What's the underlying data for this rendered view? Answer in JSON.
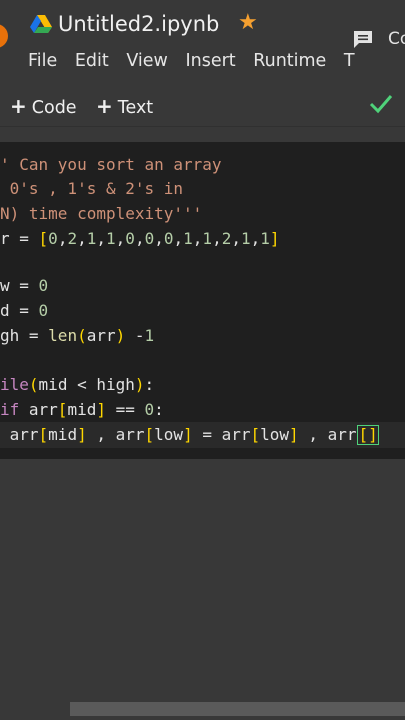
{
  "header": {
    "title": "Untitled2.ipynb",
    "share_label": "Co",
    "accent_star": "#f5a030"
  },
  "menu": [
    "File",
    "Edit",
    "View",
    "Insert",
    "Runtime",
    "T"
  ],
  "toolbar": {
    "code_label": "Code",
    "text_label": "Text"
  },
  "code_lines": [
    "' Can you sort an array",
    " 0's , 1's & 2's in",
    "N) time complexity'''",
    "r = [0,2,1,1,0,0,0,1,1,2,1,1]",
    "",
    "w = 0",
    "d = 0",
    "gh = len(arr) -1",
    "",
    "ile(mid < high):",
    "if arr[mid] == 0:",
    " arr[mid] , arr[low] = arr[low] , arr[]"
  ],
  "colors": {
    "background": "#383838",
    "editor": "#1f1f1f",
    "string": "#ce9178",
    "number": "#b5cea8",
    "keyword": "#c586c0",
    "bracket": "#ffd700",
    "check": "#4fd27a"
  }
}
